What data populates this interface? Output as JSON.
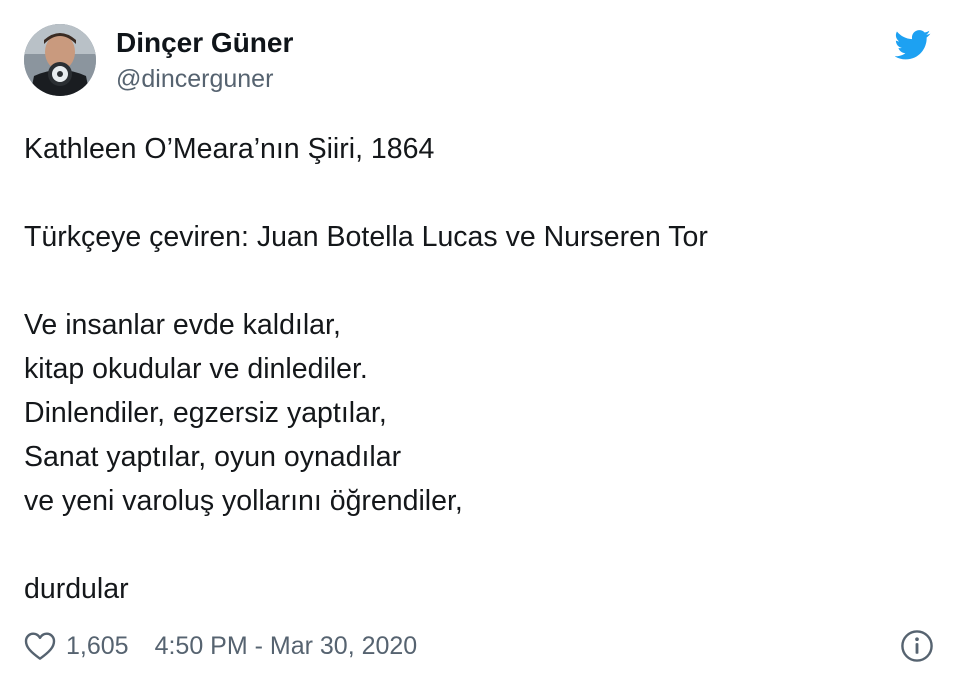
{
  "author": {
    "name": "Dinçer Güner",
    "handle": "@dincerguner"
  },
  "tweet": {
    "lines": [
      "Kathleen O’Meara’nın Şiiri, 1864",
      "",
      "Türkçeye çeviren: Juan Botella Lucas ve Nurseren Tor",
      "",
      "Ve insanlar evde kaldılar,",
      "kitap okudular ve dinlediler.",
      "Dinlendiler, egzersiz yaptılar,",
      "Sanat yaptılar, oyun oynadılar",
      "ve yeni varoluş yollarını öğrendiler,",
      "",
      "durdular"
    ]
  },
  "footer": {
    "likes": "1,605",
    "timestamp": "4:50 PM - Mar 30, 2020"
  },
  "icons": {
    "brand": "twitter-bird-icon",
    "like": "heart-icon",
    "info": "info-icon"
  },
  "colors": {
    "brand": "#1da1f2",
    "text": "#14171a",
    "secondary": "#566370"
  }
}
